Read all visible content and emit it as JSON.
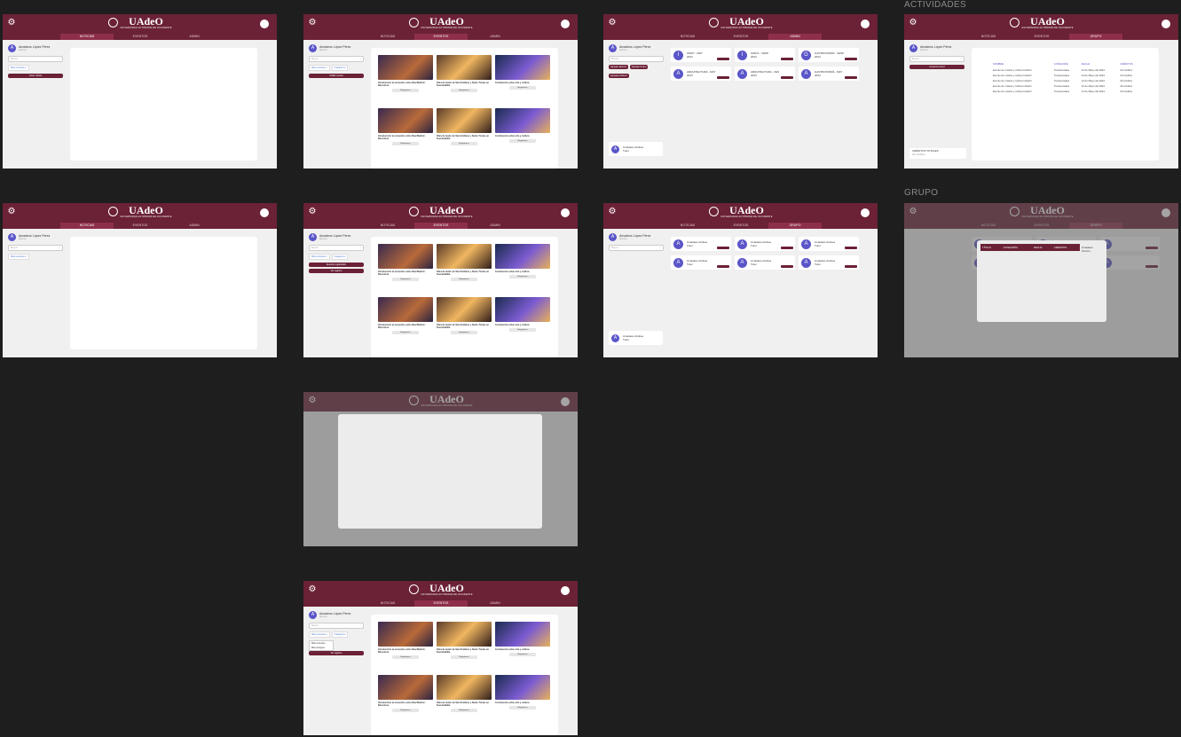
{
  "brand": {
    "name": "UAdeO",
    "tagline": "UNIVERSIDAD AUTÓNOMA DE OCCIDENTE"
  },
  "tabs": {
    "noticias": "NOTICIAS",
    "eventos": "EVENTOS",
    "admin": "ADMIN",
    "grupo": "GRUPO"
  },
  "labels": {
    "actividades": "ACTIVIDADES",
    "grupo": "GRUPO"
  },
  "user": {
    "name": "Amadeus López Pérez",
    "role": "Alumno",
    "short": "Amadeus Andrea",
    "short_role": "Tutor"
  },
  "sidebar": {
    "search_placeholder": "Buscar",
    "filter_latest": "Más recientes ▾",
    "filter_category": "Categoría ▾",
    "create_news": "Crear noticia",
    "add_event": "Añadir evento",
    "my_registrations": "Eventos registrados",
    "view_registered": "Ver registro",
    "create_user": "Agregar alumno",
    "add_group": "Agregar Grupo",
    "add_professor": "Agregar profesor",
    "generate_record": "Generar record",
    "credits_total": "CRÉDITOS TOTALES",
    "credits_value": "30 créditos"
  },
  "events": [
    {
      "title": "Introducción al encuentro entre Real Madrid - Barcelona",
      "button": "Registrarse"
    },
    {
      "title": "Obra de teatro de San Emiliano y Santo Tomás en Fuentealbilla",
      "button": "Registrarse"
    },
    {
      "title": "Conferencia sobre arte y cultura",
      "button": "Registrarse"
    },
    {
      "title": "Introducción al encuentro entre Real Madrid - Barcelona",
      "button": "Registrarse"
    },
    {
      "title": "Obra de teatro de San Emiliano y Santo Tomás en Fuentealbilla",
      "button": "Registrarse"
    },
    {
      "title": "Conferencia sobre arte y cultura",
      "button": "Registrarse"
    }
  ],
  "groups": [
    {
      "icon": "I",
      "name": "ISOFT - MAT",
      "sub": "2024"
    },
    {
      "icon": "I",
      "name": "ISOFO - VESP",
      "sub": "2024"
    },
    {
      "icon": "G",
      "name": "GASTRONOMÍA - VESP",
      "sub": "2024"
    },
    {
      "icon": "A",
      "name": "ARQUITECTURA - MAT",
      "sub": "2024"
    },
    {
      "icon": "A",
      "name": "ARQUITECTURA - VES",
      "sub": "2024"
    },
    {
      "icon": "A",
      "name": "GASTRONOMÍA - MAT",
      "sub": "2024"
    }
  ],
  "records": {
    "headers": [
      "NOMBRE",
      "CATEGORÍA",
      "FECHA",
      "CRÉDITOS"
    ],
    "rows": [
      [
        "Evento de música y cultura UAdeO",
        "Transversales",
        "12 de Mayo del 2024",
        "20 créditos"
      ],
      [
        "Evento de música y cultura UAdeO",
        "Transversales",
        "12 de Mayo del 2024",
        "20 créditos"
      ],
      [
        "Evento de música y cultura UAdeO",
        "Transversales",
        "12 de Mayo del 2024",
        "20 créditos"
      ],
      [
        "Evento de música y cultura UAdeO",
        "Transversales",
        "12 de Mayo del 2024",
        "20 créditos"
      ],
      [
        "Evento de música y cultura UAdeO",
        "Transversales",
        "12 de Mayo del 2024",
        "20 créditos"
      ]
    ]
  },
  "group_modal": {
    "headers": [
      "TÍTULO",
      "CATEGORÍA",
      "FECHA",
      "CRÉDITOS"
    ],
    "student": "Amadeus Orozco"
  },
  "dropdown": {
    "opt1": "Más recientes",
    "opt2": "Más antiguos"
  }
}
